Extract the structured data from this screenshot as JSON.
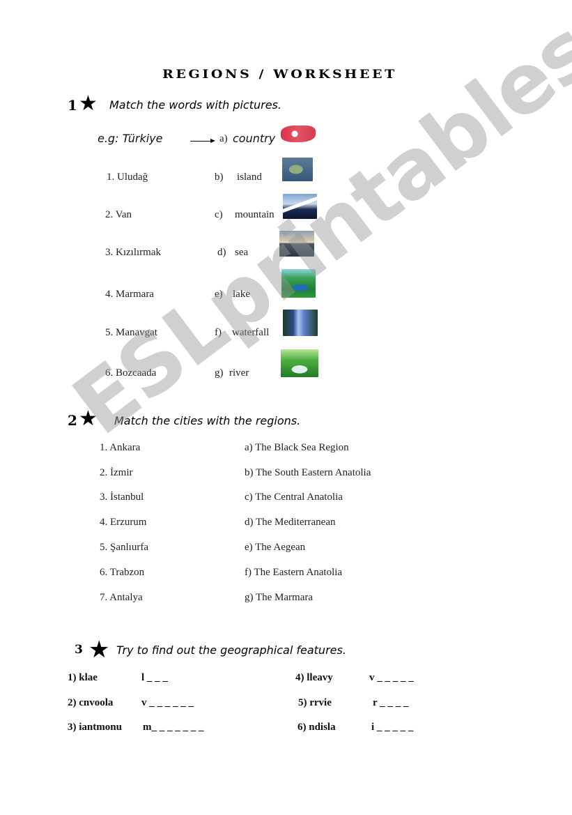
{
  "title": "REGIONS / WORKSHEET",
  "watermark": "ESLprintables.com",
  "section1": {
    "number": "1",
    "instruction": "Match the words with pictures.",
    "example": {
      "left": "e.g: Türkiye",
      "letter": "a)",
      "word": "country",
      "picture": "turkey-flag-map"
    },
    "left_items": [
      "1. Uludağ",
      "2.  Van",
      "3. Kızılırmak",
      "4. Marmara",
      "5. Manavgat",
      "6. Bozcaada"
    ],
    "right_items": [
      {
        "letter": "b)",
        "word": "island",
        "picture": "island-photo"
      },
      {
        "letter": "c)",
        "word": "mountain",
        "picture": "mountain-photo"
      },
      {
        "letter": "d)",
        "word": "sea",
        "picture": "sea-photo"
      },
      {
        "letter": "e)",
        "word": "lake",
        "picture": "lake-photo"
      },
      {
        "letter": "f)",
        "word": "waterfall",
        "picture": "waterfall-photo"
      },
      {
        "letter": "g)",
        "word": "river",
        "picture": "river-photo"
      }
    ]
  },
  "section2": {
    "number": "2",
    "instruction": "Match the cities with the regions.",
    "cities": [
      "1. Ankara",
      "2. İzmir",
      "3. İstanbul",
      "4. Erzurum",
      "5. Şanlıurfa",
      "6. Trabzon",
      "7. Antalya"
    ],
    "regions": [
      "a)  The Black Sea Region",
      "b)  The South Eastern Anatolia",
      "c)  The Central Anatolia",
      "d) The Mediterranean",
      "e)  The Aegean",
      "f)  The Eastern Anatolia",
      "g)  The Marmara"
    ]
  },
  "section3": {
    "number": "3",
    "instruction": "Try to find out the geographical features.",
    "items": [
      {
        "label": "1)  klae",
        "answer": "l _ _ _"
      },
      {
        "label": "2)  cnvoola",
        "answer": "v _ _ _ _ _ _"
      },
      {
        "label": "3)  iantmonu",
        "answer": "m_ _ _ _ _ _ _"
      },
      {
        "label": "4)  lleavy",
        "answer": "v _ _ _ _ _"
      },
      {
        "label": "5)  rrvie",
        "answer": "r _ _ _ _"
      },
      {
        "label": "6)  ndisla",
        "answer": "i _ _ _ _ _"
      }
    ]
  }
}
